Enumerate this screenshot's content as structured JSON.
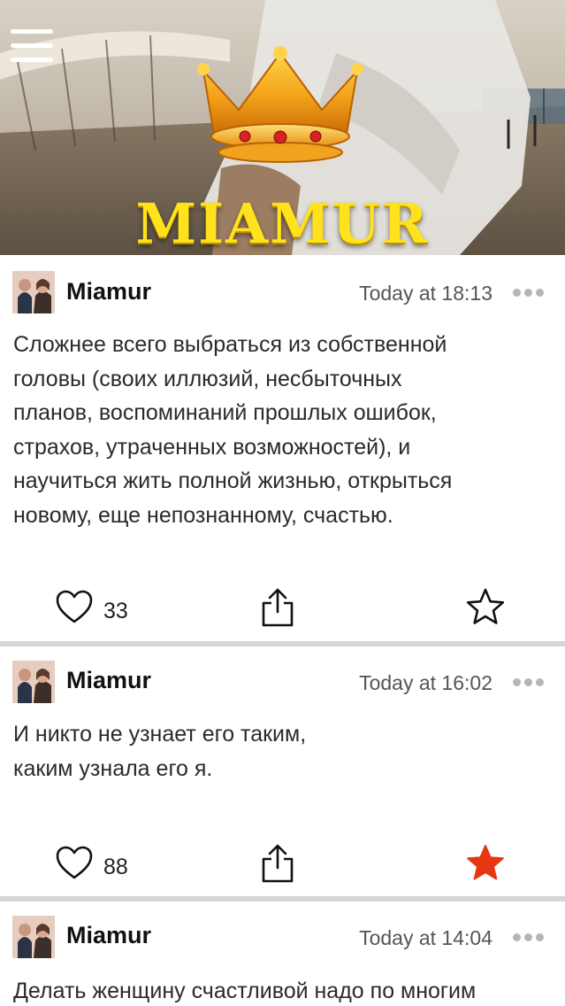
{
  "app": {
    "brand": "MIAMUR",
    "menu_icon": "hamburger-menu-icon",
    "crown_icon": "crown-icon"
  },
  "colors": {
    "brand_yellow": "#ffe21c",
    "favorite_active": "#e53712",
    "icon_stroke": "#111111",
    "divider": "#d6d6d6",
    "timestamp": "#555555"
  },
  "posts": [
    {
      "author": "Miamur",
      "time": "Today at 18:13",
      "text": "Сложнее всего выбраться из собственной\nголовы (своих иллюзий, несбыточных\nпланов, воспоминаний прошлых ошибок,\nстрахов, утраченных возможностей), и\nнаучиться жить полной жизнью, открыться\nновому, еще непознанному, счастью.",
      "likes": "33",
      "favorited": false
    },
    {
      "author": "Miamur",
      "time": "Today at 16:02",
      "text": "И никто не узнает его таким,\nкаким узнала его я.",
      "likes": "88",
      "favorited": true
    },
    {
      "author": "Miamur",
      "time": "Today at 14:04",
      "text": "Делать женщину счастливой надо по многим",
      "likes": "",
      "favorited": false
    }
  ]
}
